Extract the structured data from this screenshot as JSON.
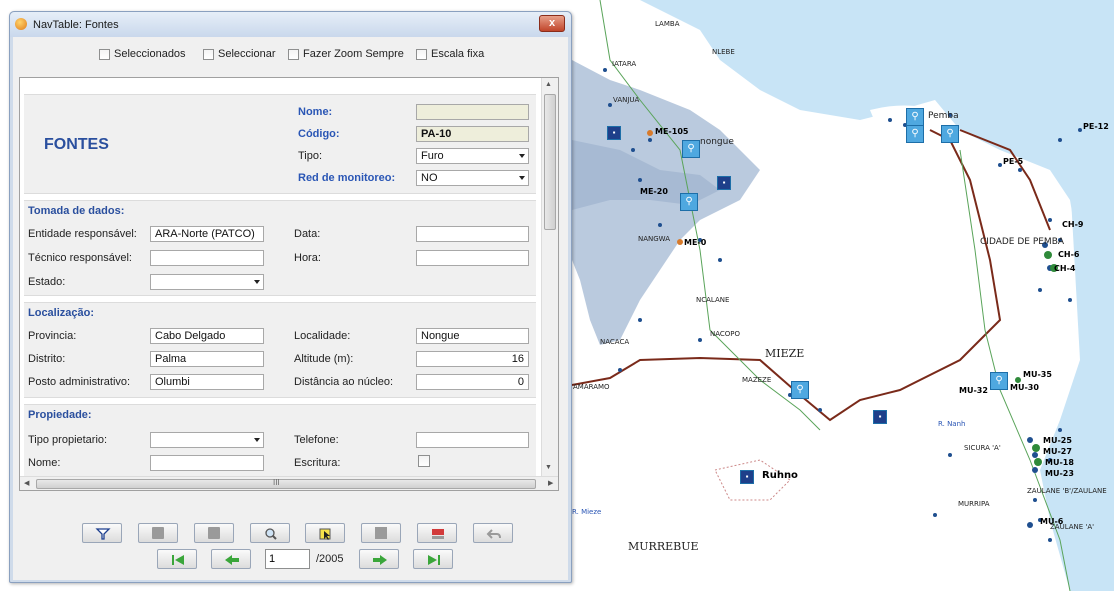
{
  "window": {
    "title": "NavTable: Fontes",
    "close_label": "x"
  },
  "topbar": {
    "selected_label": "Seleccionados",
    "select_label": "Seleccionar",
    "zoom_label": "Fazer Zoom Sempre",
    "scale_label": "Escala fixa"
  },
  "header": {
    "title": "FONTES",
    "name_label": "Nome:",
    "name_value": "",
    "code_label": "Código:",
    "code_value": "PA-10",
    "type_label": "Tipo:",
    "type_value": "Furo",
    "network_label": "Red de monitoreo:",
    "network_value": "NO"
  },
  "data_capture": {
    "title": "Tomada de dados:",
    "entity_label": "Entidade responsável:",
    "entity_value": "ARA-Norte (PATCO)",
    "tech_label": "Técnico responsável:",
    "tech_value": "",
    "state_label": "Estado:",
    "state_value": "",
    "date_label": "Data:",
    "date_value": "",
    "time_label": "Hora:",
    "time_value": ""
  },
  "location": {
    "title": "Localização:",
    "province_label": "Provincia:",
    "province_value": "Cabo Delgado",
    "district_label": "Distrito:",
    "district_value": "Palma",
    "post_label": "Posto administrativo:",
    "post_value": "Olumbi",
    "locality_label": "Localidade:",
    "locality_value": "Nongue",
    "altitude_label": "Altitude (m):",
    "altitude_value": "16",
    "distance_label": "Distância ao núcleo:",
    "distance_value": "0"
  },
  "property": {
    "title": "Propiedade:",
    "owner_type_label": "Tipo propietario:",
    "owner_type_value": "",
    "name_label": "Nome:",
    "name_value": "",
    "phone_label": "Telefone:",
    "phone_value": "",
    "deed_label": "Escritura:"
  },
  "scroll": {
    "grip": "III"
  },
  "nav": {
    "record": "1",
    "total": "/2005"
  },
  "map_labels": {
    "lambaa": "LAMBA",
    "iatara": "IATARA",
    "vanjua": "VANJUA",
    "nlebe": "NLEBE",
    "me105": "ME-105",
    "nongue": "nongue",
    "pemba": "Pemba",
    "pe12": "PE-12",
    "pe5": "PE-5",
    "me20": "ME-20",
    "me0": "ME-0",
    "cidade": "CIDADE DE PEMBA",
    "ch9": "CH-9",
    "ch6": "CH-6",
    "ch4": "CH-4",
    "nangwa": "NANGWA",
    "ncalane": "NCALANE",
    "nacopo": "NACOPO",
    "nacaca": "NACACA",
    "mieze": "MIEZE",
    "amaramo": "AMARAMO",
    "mazeze": "MAZEZE",
    "mu35": "MU-35",
    "mu30": "MU-30",
    "mu32": "MU-32",
    "mu25": "MU-25",
    "mu27": "MU-27",
    "mu18": "MU-18",
    "mu23": "MU-23",
    "mu6": "MU-6",
    "sicura": "SICURA 'A'",
    "r_nanh": "R. Nanh",
    "ruhno": "Ruhno",
    "murrebue": "MURREBUE",
    "murripa": "MURRIPA",
    "mieze_r": "R. Mieze",
    "zaulane": "ZAULANE 'B'/ZAULANE",
    "zaulane_a": "ZAULANE 'A'"
  },
  "colors": {
    "sea": "#c8e4f6",
    "highlight": "#a9bdd6",
    "road": "#7a2a1a",
    "section_title": "#2a4f9e"
  }
}
